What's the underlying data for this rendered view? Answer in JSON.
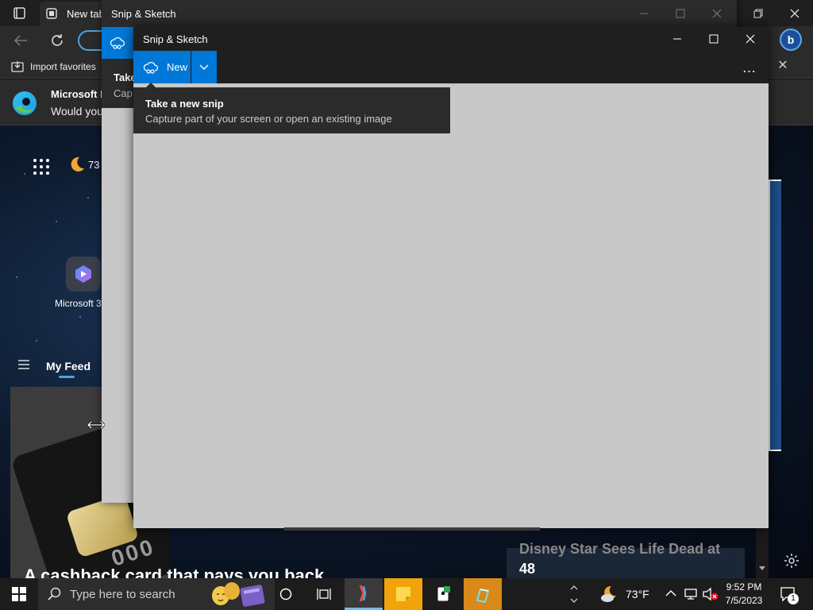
{
  "browser": {
    "tab_title": "New tab",
    "favorites_import_label": "Import favorites",
    "banner": {
      "title": "Microsoft E",
      "text": "Would you"
    },
    "weather_temp": "73",
    "tile_label": "Microsoft 3",
    "feed_label": "My Feed",
    "card_digits": "000",
    "news_headline": "A cashback card that pays you back",
    "right_news_blur": "Disney Star Sees Life Dead at",
    "right_news_number": "48"
  },
  "snip_back": {
    "title": "Snip & Sketch",
    "tip_title": "Take",
    "tip_sub": "Cap"
  },
  "snip": {
    "title": "Snip & Sketch",
    "new_label": "New",
    "tooltip_title": "Take a new snip",
    "tooltip_sub": "Capture part of your screen or open an existing image",
    "more_label": "…"
  },
  "taskbar": {
    "search_placeholder": "Type here to search",
    "weather_temp": "73°F",
    "time": "9:52 PM",
    "date": "7/5/2023",
    "notification_count": "1"
  },
  "colors": {
    "accent": "#0078d7",
    "canvas": "#c8c8c8",
    "titlebar_dark": "#1f1f1f"
  }
}
